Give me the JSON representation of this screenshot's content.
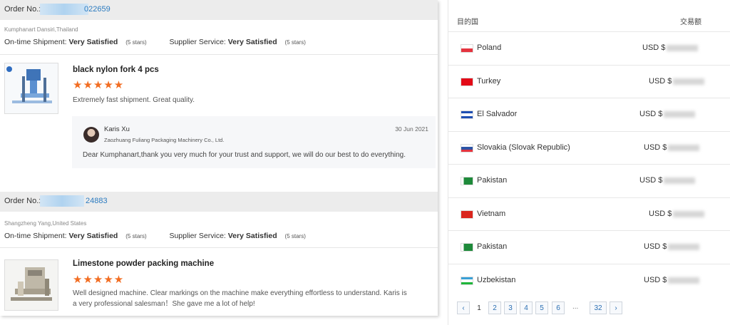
{
  "orders": [
    {
      "order_label": "Order No.:",
      "order_number_visible": "022659",
      "buyer_location": "Kumphanart Dansiri,Thailand",
      "ontime_label": "On-time Shipment:",
      "ontime_value": "Very Satisfied",
      "ontime_stars": "(5 stars)",
      "supplier_label": "Supplier Service:",
      "supplier_value": "Very Satisfied",
      "supplier_stars": "(5 stars)",
      "product_title": "black nylon fork 4 pcs",
      "stars": "★★★★★",
      "review": "Extremely fast shipment.  Great quality.",
      "reply": {
        "name": "Karis Xu",
        "company": "Zaozhuang Fuliang Packaging Machinery Co., Ltd.",
        "date": "30 Jun 2021",
        "text": "Dear Kumphanart,thank you very much for your trust and support, we will do our best to do everything."
      }
    },
    {
      "order_label": "Order No.:",
      "order_number_visible": "24883",
      "buyer_location": "Shangzheng Yang,United States",
      "ontime_label": "On-time Shipment:",
      "ontime_value": "Very Satisfied",
      "ontime_stars": "(5 stars)",
      "supplier_label": "Supplier Service:",
      "supplier_value": "Very Satisfied",
      "supplier_stars": "(5 stars)",
      "product_title": "Limestone powder packing machine",
      "stars": "★★★★★",
      "review_line1": "Well designed machine. Clear markings on the machine make everything effortless to understand. Karis is",
      "review_line2": "a very professional salesman！She gave me a lot of help!"
    }
  ],
  "transactions": {
    "header_country": "目的国",
    "header_amount": "交易额",
    "rows": [
      {
        "country": "Poland",
        "amount": "USD $",
        "flag_color": "#e4343f"
      },
      {
        "country": "Turkey",
        "amount": "USD $",
        "flag_color": "#e30a17"
      },
      {
        "country": "El Salvador",
        "amount": "USD $",
        "flag_color": "#1f4fb3"
      },
      {
        "country": "Slovakia (Slovak Republic)",
        "amount": "USD $",
        "flag_color": "#2c54a6"
      },
      {
        "country": "Pakistan",
        "amount": "USD $",
        "flag_color": "#1e8a3a"
      },
      {
        "country": "Vietnam",
        "amount": "USD $",
        "flag_color": "#da251d"
      },
      {
        "country": "Pakistan",
        "amount": "USD $",
        "flag_color": "#1e8a3a"
      },
      {
        "country": "Uzbekistan",
        "amount": "USD $",
        "flag_color": "#1eb53a"
      }
    ]
  },
  "pagination": {
    "prev": "‹",
    "pages": [
      "1",
      "2",
      "3",
      "4",
      "5",
      "6"
    ],
    "ellipsis": "...",
    "last": "32",
    "next": "›",
    "current": "1"
  },
  "colors": {
    "star": "#f26d22",
    "link": "#2b7bc0",
    "order_bar": "#ececec"
  }
}
